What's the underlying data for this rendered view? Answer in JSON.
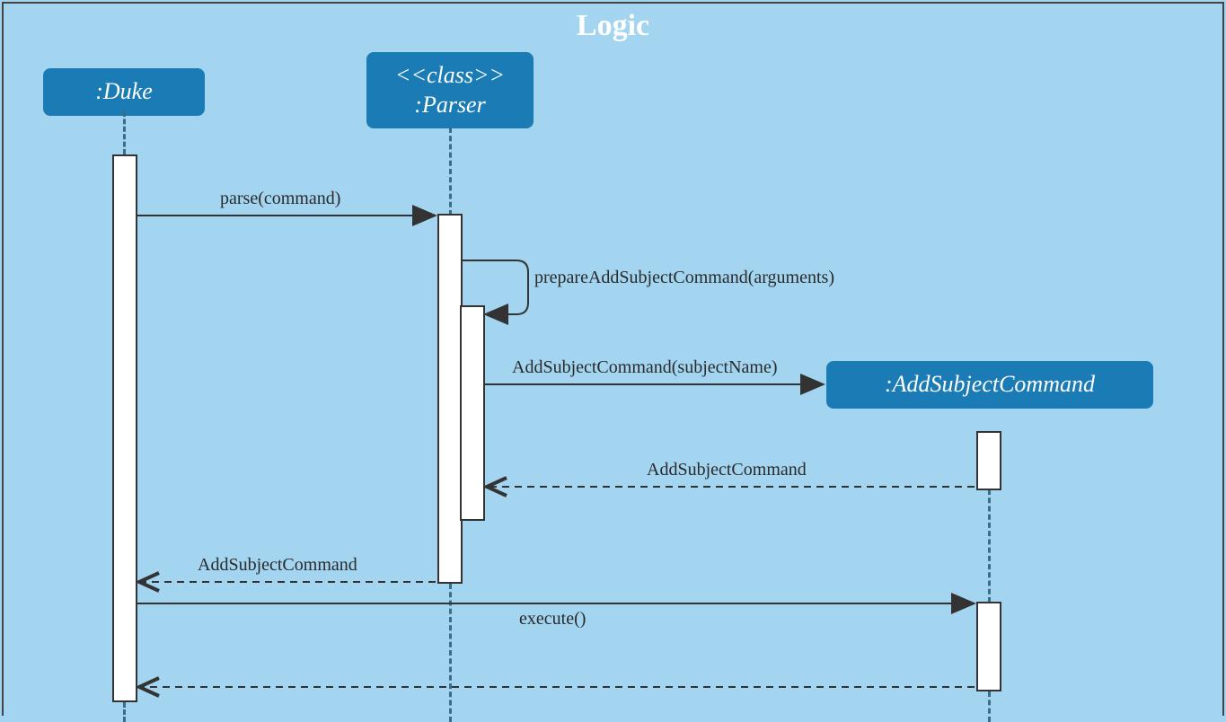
{
  "title": "Logic",
  "participants": {
    "duke": {
      "label": ":Duke"
    },
    "parser": {
      "stereotype": "<<class>>",
      "label": ":Parser"
    },
    "addsubject": {
      "label": ":AddSubjectCommand"
    }
  },
  "messages": {
    "m1": "parse(command)",
    "m2": "prepareAddSubjectCommand(arguments)",
    "m3": "AddSubjectCommand(subjectName)",
    "m4": "AddSubjectCommand",
    "m5": "AddSubjectCommand",
    "m6": "execute()"
  },
  "chart_data": {
    "type": "sequence_diagram",
    "title": "Logic",
    "participants": [
      {
        "name": ":Duke"
      },
      {
        "name": ":Parser",
        "stereotype": "<<class>>"
      },
      {
        "name": ":AddSubjectCommand",
        "created_by_message": 3
      }
    ],
    "interactions": [
      {
        "seq": 1,
        "from": ":Duke",
        "to": ":Parser",
        "label": "parse(command)",
        "type": "sync"
      },
      {
        "seq": 2,
        "from": ":Parser",
        "to": ":Parser",
        "label": "prepareAddSubjectCommand(arguments)",
        "type": "self"
      },
      {
        "seq": 3,
        "from": ":Parser",
        "to": ":AddSubjectCommand",
        "label": "AddSubjectCommand(subjectName)",
        "type": "create"
      },
      {
        "seq": 4,
        "from": ":AddSubjectCommand",
        "to": ":Parser",
        "label": "AddSubjectCommand",
        "type": "return"
      },
      {
        "seq": 5,
        "from": ":Parser",
        "to": ":Duke",
        "label": "AddSubjectCommand",
        "type": "return"
      },
      {
        "seq": 6,
        "from": ":Duke",
        "to": ":AddSubjectCommand",
        "label": "execute()",
        "type": "sync"
      },
      {
        "seq": 7,
        "from": ":AddSubjectCommand",
        "to": ":Duke",
        "label": "",
        "type": "return"
      }
    ]
  }
}
